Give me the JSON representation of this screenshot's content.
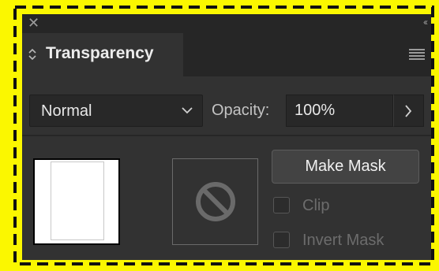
{
  "colors": {
    "highlight": "#fbf700",
    "dash": "#111111",
    "panel_bg": "#323232",
    "header_bg": "#262626",
    "field_bg": "#282828",
    "text": "#ececec",
    "disabled_text": "#6c6c6c"
  },
  "window": {
    "close_icon": "close-icon",
    "collapse_icon": "collapse-double-chevron-icon"
  },
  "panel": {
    "tab_label": "Transparency",
    "tab_icon": "updown-arrows-icon",
    "menu_icon": "hamburger-menu-icon"
  },
  "blend_mode": {
    "selected": "Normal",
    "icon": "chevron-down-icon"
  },
  "opacity": {
    "label": "Opacity:",
    "value": "100%",
    "stepper_icon": "chevron-right-icon"
  },
  "mask": {
    "make_mask_label": "Make Mask",
    "empty_slot_icon": "no-symbol-icon",
    "clip_label": "Clip",
    "clip_checked": false,
    "clip_enabled": false,
    "invert_label": "Invert Mask",
    "invert_checked": false,
    "invert_enabled": false
  }
}
